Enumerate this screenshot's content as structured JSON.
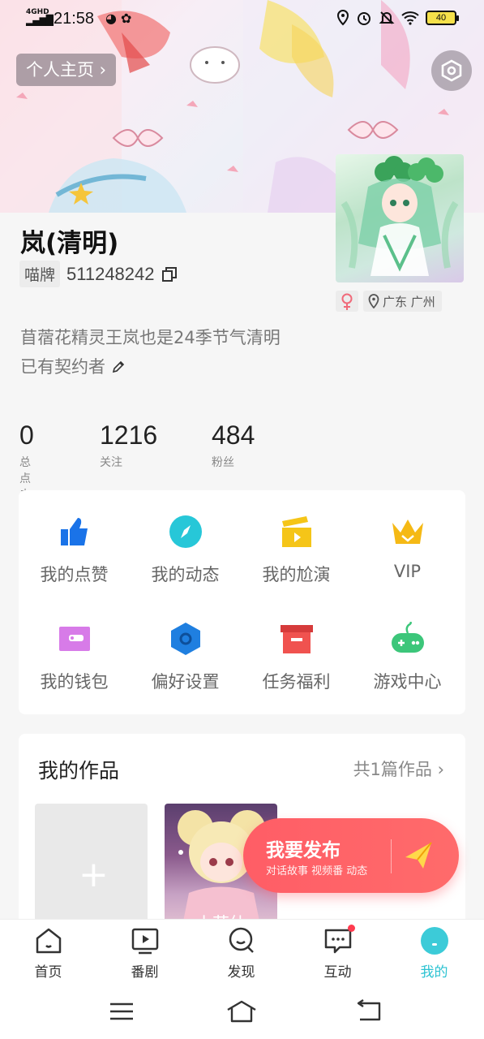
{
  "status_bar": {
    "time": "21:58",
    "network": "4GHD",
    "battery": "40"
  },
  "header": {
    "homepage_label": "个人主页 ›"
  },
  "profile": {
    "name": "岚(清明)",
    "id_tag": "喵牌",
    "id_number": "511248242",
    "location": "广东 广州",
    "bio_line1": "苜蓿花精灵王岚也是24季节气清明",
    "bio_line2": "已有契约者"
  },
  "stats": [
    {
      "value": "0",
      "label": "总点击"
    },
    {
      "value": "1216",
      "label": "关注"
    },
    {
      "value": "484",
      "label": "粉丝"
    }
  ],
  "grid": [
    {
      "label": "我的点赞",
      "icon": "thumbs-up-icon",
      "color": "#1a73e8"
    },
    {
      "label": "我的动态",
      "icon": "compass-icon",
      "color": "#27c7d8"
    },
    {
      "label": "我的尬演",
      "icon": "clapperboard-icon",
      "color": "#f5c518"
    },
    {
      "label": "VIP",
      "icon": "crown-icon",
      "color": "#f5b915"
    },
    {
      "label": "我的钱包",
      "icon": "wallet-icon",
      "color": "#d77be8"
    },
    {
      "label": "偏好设置",
      "icon": "hexagon-settings-icon",
      "color": "#1f7fe0"
    },
    {
      "label": "任务福利",
      "icon": "gift-box-icon",
      "color": "#f0524f"
    },
    {
      "label": "游戏中心",
      "icon": "gamepad-icon",
      "color": "#3cc67a"
    }
  ],
  "works": {
    "title": "我的作品",
    "count": "共1篇作品 ›",
    "items": [
      {
        "title": "小花仙"
      }
    ]
  },
  "publish": {
    "title": "我要发布",
    "subtitle": "对话故事  视频番  动态"
  },
  "tabs": [
    {
      "label": "首页",
      "icon": "home-icon"
    },
    {
      "label": "番剧",
      "icon": "play-icon"
    },
    {
      "label": "发现",
      "icon": "discover-icon"
    },
    {
      "label": "互动",
      "icon": "message-icon"
    },
    {
      "label": "我的",
      "icon": "profile-icon"
    }
  ],
  "colors": {
    "accent": "#2cc3d2",
    "publish": "#ff5d66"
  }
}
